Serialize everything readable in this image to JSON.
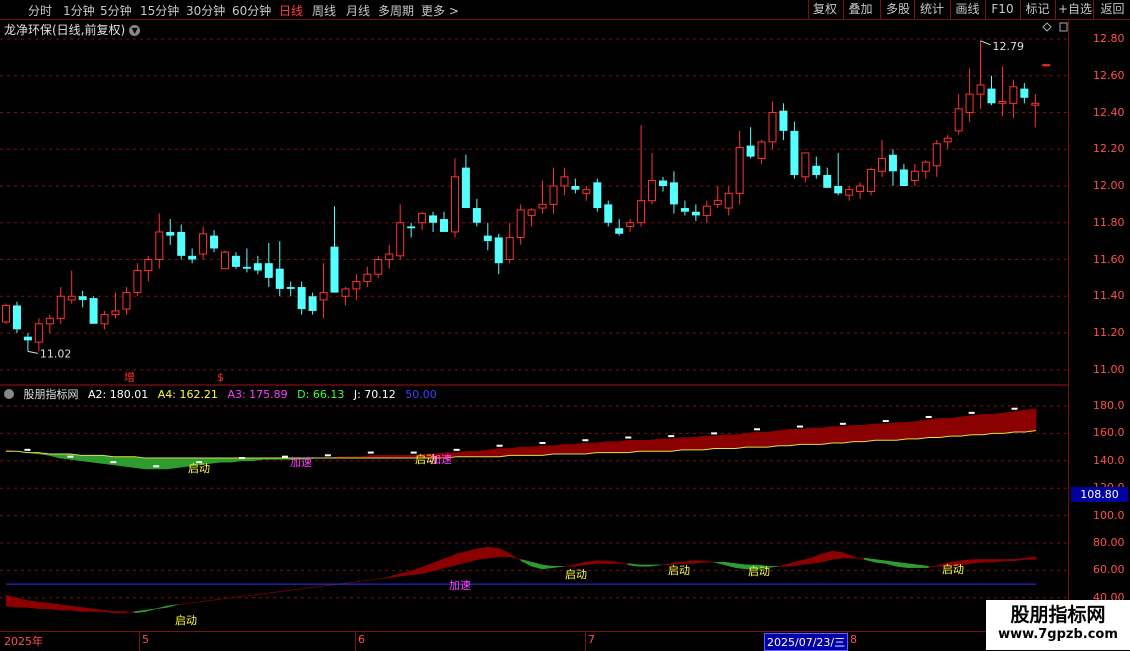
{
  "toolbar": {
    "tabs": [
      "分时",
      "1分钟",
      "5分钟",
      "15分钟",
      "30分钟",
      "60分钟",
      "日线",
      "周线",
      "月线",
      "多周期",
      "更多 >"
    ],
    "right_buttons": [
      "复权",
      "叠加",
      "多股",
      "统计",
      "画线",
      "F10",
      "标记",
      "+自选",
      "返回"
    ]
  },
  "title": "龙净环保(日线,前复权)",
  "price_chart": {
    "price_ticks": [
      "12.80",
      "12.60",
      "12.40",
      "12.20",
      "12.00",
      "11.80",
      "11.60",
      "11.40",
      "11.20",
      "11.00"
    ],
    "high_label": "12.79",
    "low_label": "11.02",
    "markers": [
      "增",
      "$"
    ],
    "colors": {
      "up": "#ff3232",
      "down": "#54ffff",
      "grid": "#7a1010"
    },
    "candles": [
      {
        "o": 11.26,
        "h": 11.36,
        "l": 11.25,
        "c": 11.35
      },
      {
        "o": 11.35,
        "h": 11.37,
        "l": 11.2,
        "c": 11.22
      },
      {
        "o": 11.18,
        "h": 11.2,
        "l": 11.1,
        "c": 11.16
      },
      {
        "o": 11.15,
        "h": 11.28,
        "l": 11.1,
        "c": 11.25
      },
      {
        "o": 11.25,
        "h": 11.3,
        "l": 11.2,
        "c": 11.28
      },
      {
        "o": 11.28,
        "h": 11.45,
        "l": 11.25,
        "c": 11.4
      },
      {
        "o": 11.38,
        "h": 11.54,
        "l": 11.36,
        "c": 11.4
      },
      {
        "o": 11.4,
        "h": 11.43,
        "l": 11.34,
        "c": 11.38
      },
      {
        "o": 11.39,
        "h": 11.4,
        "l": 11.27,
        "c": 11.25
      },
      {
        "o": 11.25,
        "h": 11.32,
        "l": 11.22,
        "c": 11.3
      },
      {
        "o": 11.3,
        "h": 11.42,
        "l": 11.28,
        "c": 11.32
      },
      {
        "o": 11.33,
        "h": 11.45,
        "l": 11.3,
        "c": 11.42
      },
      {
        "o": 11.42,
        "h": 11.58,
        "l": 11.4,
        "c": 11.54
      },
      {
        "o": 11.54,
        "h": 11.62,
        "l": 11.48,
        "c": 11.6
      },
      {
        "o": 11.6,
        "h": 11.85,
        "l": 11.55,
        "c": 11.75
      },
      {
        "o": 11.75,
        "h": 11.82,
        "l": 11.68,
        "c": 11.73
      },
      {
        "o": 11.75,
        "h": 11.79,
        "l": 11.6,
        "c": 11.62
      },
      {
        "o": 11.62,
        "h": 11.66,
        "l": 11.58,
        "c": 11.6
      },
      {
        "o": 11.63,
        "h": 11.78,
        "l": 11.6,
        "c": 11.74
      },
      {
        "o": 11.73,
        "h": 11.76,
        "l": 11.64,
        "c": 11.66
      },
      {
        "o": 11.55,
        "h": 11.65,
        "l": 11.55,
        "c": 11.64
      },
      {
        "o": 11.62,
        "h": 11.64,
        "l": 11.55,
        "c": 11.56
      },
      {
        "o": 11.56,
        "h": 11.66,
        "l": 11.53,
        "c": 11.55
      },
      {
        "o": 11.58,
        "h": 11.62,
        "l": 11.52,
        "c": 11.54
      },
      {
        "o": 11.58,
        "h": 11.69,
        "l": 11.45,
        "c": 11.5
      },
      {
        "o": 11.55,
        "h": 11.7,
        "l": 11.4,
        "c": 11.44
      },
      {
        "o": 11.45,
        "h": 11.48,
        "l": 11.4,
        "c": 11.44
      },
      {
        "o": 11.45,
        "h": 11.48,
        "l": 11.3,
        "c": 11.33
      },
      {
        "o": 11.4,
        "h": 11.42,
        "l": 11.3,
        "c": 11.32
      },
      {
        "o": 11.38,
        "h": 11.58,
        "l": 11.28,
        "c": 11.42
      },
      {
        "o": 11.67,
        "h": 11.89,
        "l": 11.6,
        "c": 11.42
      },
      {
        "o": 11.4,
        "h": 11.45,
        "l": 11.35,
        "c": 11.44
      },
      {
        "o": 11.44,
        "h": 11.52,
        "l": 11.38,
        "c": 11.48
      },
      {
        "o": 11.48,
        "h": 11.56,
        "l": 11.45,
        "c": 11.52
      },
      {
        "o": 11.52,
        "h": 11.62,
        "l": 11.5,
        "c": 11.6
      },
      {
        "o": 11.6,
        "h": 11.68,
        "l": 11.55,
        "c": 11.63
      },
      {
        "o": 11.62,
        "h": 11.9,
        "l": 11.6,
        "c": 11.8
      },
      {
        "o": 11.78,
        "h": 11.8,
        "l": 11.72,
        "c": 11.77
      },
      {
        "o": 11.8,
        "h": 11.86,
        "l": 11.76,
        "c": 11.85
      },
      {
        "o": 11.84,
        "h": 11.86,
        "l": 11.75,
        "c": 11.8
      },
      {
        "o": 11.82,
        "h": 11.86,
        "l": 11.76,
        "c": 11.75
      },
      {
        "o": 11.75,
        "h": 12.15,
        "l": 11.72,
        "c": 12.05
      },
      {
        "o": 12.1,
        "h": 12.17,
        "l": 11.95,
        "c": 11.88
      },
      {
        "o": 11.88,
        "h": 11.93,
        "l": 11.78,
        "c": 11.8
      },
      {
        "o": 11.73,
        "h": 11.8,
        "l": 11.65,
        "c": 11.7
      },
      {
        "o": 11.72,
        "h": 11.74,
        "l": 11.52,
        "c": 11.58
      },
      {
        "o": 11.6,
        "h": 11.8,
        "l": 11.58,
        "c": 11.72
      },
      {
        "o": 11.72,
        "h": 11.9,
        "l": 11.68,
        "c": 11.87
      },
      {
        "o": 11.84,
        "h": 11.88,
        "l": 11.78,
        "c": 11.87
      },
      {
        "o": 11.88,
        "h": 12.03,
        "l": 11.85,
        "c": 11.9
      },
      {
        "o": 11.9,
        "h": 12.1,
        "l": 11.85,
        "c": 12.0
      },
      {
        "o": 12.0,
        "h": 12.1,
        "l": 11.95,
        "c": 12.05
      },
      {
        "o": 12.0,
        "h": 12.04,
        "l": 11.96,
        "c": 11.98
      },
      {
        "o": 11.96,
        "h": 12.0,
        "l": 11.92,
        "c": 11.98
      },
      {
        "o": 12.02,
        "h": 12.04,
        "l": 11.86,
        "c": 11.88
      },
      {
        "o": 11.9,
        "h": 11.92,
        "l": 11.78,
        "c": 11.8
      },
      {
        "o": 11.77,
        "h": 11.82,
        "l": 11.73,
        "c": 11.74
      },
      {
        "o": 11.78,
        "h": 11.82,
        "l": 11.75,
        "c": 11.8
      },
      {
        "o": 11.8,
        "h": 12.33,
        "l": 11.78,
        "c": 11.92
      },
      {
        "o": 11.92,
        "h": 12.18,
        "l": 11.9,
        "c": 12.03
      },
      {
        "o": 12.03,
        "h": 12.05,
        "l": 11.97,
        "c": 12.0
      },
      {
        "o": 12.02,
        "h": 12.08,
        "l": 11.85,
        "c": 11.9
      },
      {
        "o": 11.88,
        "h": 11.92,
        "l": 11.84,
        "c": 11.86
      },
      {
        "o": 11.86,
        "h": 11.9,
        "l": 11.81,
        "c": 11.84
      },
      {
        "o": 11.84,
        "h": 11.92,
        "l": 11.8,
        "c": 11.89
      },
      {
        "o": 11.9,
        "h": 12.0,
        "l": 11.88,
        "c": 11.92
      },
      {
        "o": 11.88,
        "h": 12.0,
        "l": 11.84,
        "c": 11.96
      },
      {
        "o": 11.96,
        "h": 12.3,
        "l": 11.9,
        "c": 12.21
      },
      {
        "o": 12.22,
        "h": 12.32,
        "l": 12.15,
        "c": 12.16
      },
      {
        "o": 12.15,
        "h": 12.25,
        "l": 12.12,
        "c": 12.24
      },
      {
        "o": 12.24,
        "h": 12.46,
        "l": 12.2,
        "c": 12.4
      },
      {
        "o": 12.41,
        "h": 12.45,
        "l": 12.25,
        "c": 12.3
      },
      {
        "o": 12.3,
        "h": 12.35,
        "l": 12.04,
        "c": 12.06
      },
      {
        "o": 12.05,
        "h": 12.18,
        "l": 12.02,
        "c": 12.18
      },
      {
        "o": 12.11,
        "h": 12.16,
        "l": 12.04,
        "c": 12.06
      },
      {
        "o": 12.06,
        "h": 12.1,
        "l": 12.0,
        "c": 11.99
      },
      {
        "o": 12.0,
        "h": 12.18,
        "l": 11.95,
        "c": 11.96
      },
      {
        "o": 11.95,
        "h": 12.0,
        "l": 11.92,
        "c": 11.98
      },
      {
        "o": 11.97,
        "h": 12.02,
        "l": 11.93,
        "c": 12.0
      },
      {
        "o": 11.97,
        "h": 12.1,
        "l": 11.95,
        "c": 12.09
      },
      {
        "o": 12.08,
        "h": 12.25,
        "l": 12.05,
        "c": 12.15
      },
      {
        "o": 12.17,
        "h": 12.2,
        "l": 12.0,
        "c": 12.08
      },
      {
        "o": 12.09,
        "h": 12.12,
        "l": 12.0,
        "c": 12.0
      },
      {
        "o": 12.03,
        "h": 12.12,
        "l": 12.0,
        "c": 12.08
      },
      {
        "o": 12.08,
        "h": 12.14,
        "l": 12.04,
        "c": 12.13
      },
      {
        "o": 12.11,
        "h": 12.25,
        "l": 12.05,
        "c": 12.23
      },
      {
        "o": 12.24,
        "h": 12.28,
        "l": 12.2,
        "c": 12.26
      },
      {
        "o": 12.3,
        "h": 12.5,
        "l": 12.28,
        "c": 12.42
      },
      {
        "o": 12.4,
        "h": 12.64,
        "l": 12.35,
        "c": 12.5
      },
      {
        "o": 12.5,
        "h": 12.79,
        "l": 12.42,
        "c": 12.55
      },
      {
        "o": 12.53,
        "h": 12.6,
        "l": 12.44,
        "c": 12.45
      },
      {
        "o": 12.45,
        "h": 12.65,
        "l": 12.38,
        "c": 12.46
      },
      {
        "o": 12.45,
        "h": 12.58,
        "l": 12.37,
        "c": 12.54
      },
      {
        "o": 12.53,
        "h": 12.56,
        "l": 12.45,
        "c": 12.48
      },
      {
        "o": 12.44,
        "h": 12.5,
        "l": 12.32,
        "c": 12.45
      },
      {
        "o": 12.66,
        "h": 12.66,
        "l": 12.66,
        "c": 12.66
      }
    ]
  },
  "indicator": {
    "name": "股朋指标网",
    "A2": {
      "label": "A2: 180.01",
      "color": "#ffffff"
    },
    "A4": {
      "label": "A4: 162.21",
      "color": "#ffff40"
    },
    "A3": {
      "label": "A3: 175.89",
      "color": "#ff40ff"
    },
    "D": {
      "label": "D: 66.13",
      "color": "#40ff40"
    },
    "J": {
      "label": "J: 70.12",
      "color": "#ffffff"
    },
    "level": {
      "label": "50.00",
      "color": "#4040ff"
    },
    "ticks": [
      "180.0",
      "160.0",
      "140.0",
      "120.0",
      "100.0",
      "80.00",
      "60.00",
      "40.00"
    ],
    "current_value": "108.80",
    "signals": [
      "启动",
      "加速",
      "启动",
      "启动",
      "启动",
      "加速",
      "启动",
      "启动",
      "启动",
      "启动",
      "启动"
    ],
    "a3": [
      148,
      147,
      146,
      145,
      144,
      142,
      141,
      140,
      139,
      138,
      137,
      136,
      135,
      134,
      134,
      134,
      135,
      136,
      137,
      138,
      139,
      139,
      140,
      140,
      141,
      141,
      141,
      141,
      141,
      142,
      142,
      143,
      143,
      143,
      144,
      144,
      144,
      144,
      144,
      145,
      145,
      146,
      146,
      147,
      147,
      148,
      149,
      149,
      150,
      150,
      151,
      151,
      152,
      152,
      153,
      153,
      154,
      154,
      155,
      155,
      155,
      156,
      156,
      157,
      157,
      158,
      158,
      159,
      159,
      160,
      161,
      161,
      162,
      163,
      163,
      164,
      164,
      165,
      165,
      166,
      166,
      167,
      167,
      168,
      168,
      169,
      170,
      171,
      171,
      172,
      173,
      174,
      174,
      175,
      176,
      177,
      178
    ],
    "a4": [
      147,
      147,
      146,
      146,
      145,
      145,
      145,
      144,
      144,
      144,
      143,
      143,
      143,
      142,
      142,
      142,
      142,
      142,
      142,
      142,
      142,
      142,
      142,
      142,
      142,
      142,
      142,
      142,
      142,
      142,
      142,
      142,
      142,
      142,
      142,
      142,
      142,
      142,
      142,
      142,
      142,
      142,
      143,
      143,
      143,
      143,
      143,
      144,
      144,
      144,
      144,
      145,
      145,
      145,
      145,
      146,
      146,
      146,
      146,
      147,
      147,
      147,
      147,
      148,
      148,
      148,
      149,
      149,
      149,
      150,
      150,
      150,
      151,
      151,
      152,
      152,
      152,
      153,
      153,
      154,
      154,
      155,
      155,
      155,
      156,
      156,
      157,
      157,
      158,
      158,
      159,
      159,
      160,
      160,
      161,
      161,
      162
    ],
    "k": [
      42,
      40,
      38,
      37,
      36,
      35,
      34,
      33,
      32,
      31,
      30,
      30,
      29,
      30,
      32,
      33,
      35,
      36,
      37,
      38,
      39,
      40,
      41,
      42,
      43,
      44,
      45,
      46,
      47,
      48,
      49,
      50,
      51,
      52,
      53,
      54,
      56,
      58,
      60,
      63,
      66,
      69,
      72,
      74,
      76,
      77,
      76,
      72,
      67,
      63,
      61,
      62,
      63,
      64,
      66,
      67,
      67,
      66,
      64,
      63,
      63,
      64,
      65,
      66,
      67,
      67,
      66,
      64,
      62,
      61,
      61,
      62,
      63,
      65,
      67,
      69,
      72,
      74,
      73,
      70,
      68,
      66,
      65,
      63,
      62,
      62,
      62,
      64,
      66,
      67,
      68,
      68,
      68,
      68,
      68,
      69,
      70
    ],
    "d": [
      34,
      33,
      33,
      32,
      32,
      31,
      31,
      30,
      30,
      30,
      29,
      29,
      30,
      31,
      32,
      34,
      35,
      36,
      37,
      38,
      39,
      40,
      41,
      42,
      43,
      44,
      45,
      46,
      47,
      48,
      49,
      50,
      51,
      52,
      53,
      54,
      55,
      56,
      57,
      58,
      60,
      62,
      64,
      66,
      68,
      69,
      70,
      70,
      68,
      66,
      64,
      63,
      63,
      63,
      64,
      65,
      65,
      65,
      65,
      64,
      64,
      64,
      64,
      65,
      65,
      66,
      66,
      66,
      65,
      64,
      64,
      63,
      63,
      63,
      64,
      65,
      66,
      68,
      69,
      69,
      69,
      68,
      67,
      66,
      65,
      64,
      63,
      63,
      63,
      64,
      65,
      66,
      66,
      67,
      67,
      68,
      68
    ]
  },
  "bottom": {
    "date_labels": [
      "2025年",
      "5",
      "6",
      "7",
      "8"
    ],
    "cursor_date": "2025/07/23/三"
  },
  "watermark": {
    "title": "股朋指标网",
    "url": "www.7gpzb.com"
  }
}
